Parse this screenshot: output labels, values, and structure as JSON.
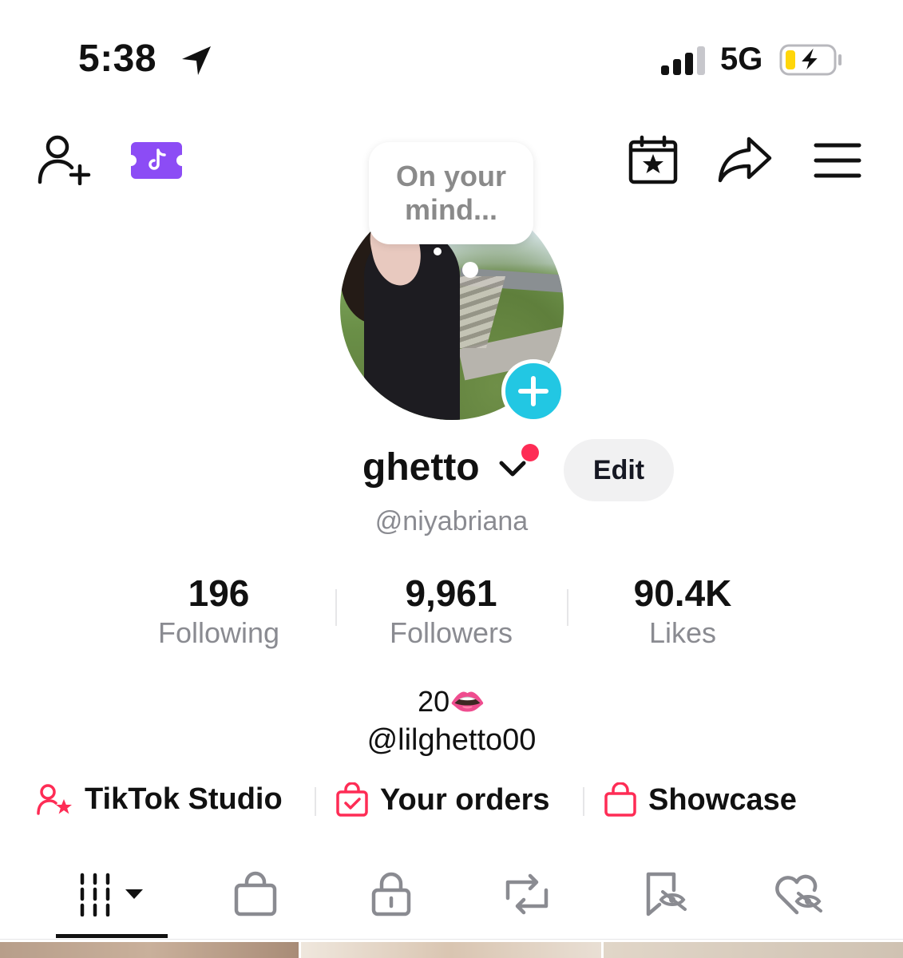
{
  "status_bar": {
    "time": "5:38",
    "network": "5G",
    "battery_charging": true
  },
  "top_bar": {
    "icons": [
      "add-user-icon",
      "tiktok-ticket-icon",
      "calendar-star-icon",
      "share-icon",
      "menu-icon"
    ]
  },
  "avatar": {
    "bubble_text": "On your mind..."
  },
  "profile": {
    "display_name": "ghetto",
    "edit_label": "Edit",
    "handle": "@niyabriana"
  },
  "stats": [
    {
      "value": "196",
      "label": "Following"
    },
    {
      "value": "9,961",
      "label": "Followers"
    },
    {
      "value": "90.4K",
      "label": "Likes"
    }
  ],
  "bio": {
    "line1": "20👄",
    "line2": "@lilghetto00"
  },
  "links": [
    {
      "label": "TikTok Studio",
      "icon": "user-star-icon"
    },
    {
      "label": "Your orders",
      "icon": "shopping-bag-check-icon"
    },
    {
      "label": "Showcase",
      "icon": "shopping-bag-icon"
    }
  ],
  "tabs": [
    "videos-grid-icon",
    "shop-icon",
    "lock-icon",
    "repost-icon",
    "saved-icon",
    "liked-icon"
  ],
  "colors": {
    "accent_red": "#fe2c55",
    "accent_cyan": "#22c7e3",
    "muted_text": "#8a8b91",
    "edit_bg": "#f1f1f2",
    "battery_fill": "#ffd60a"
  }
}
